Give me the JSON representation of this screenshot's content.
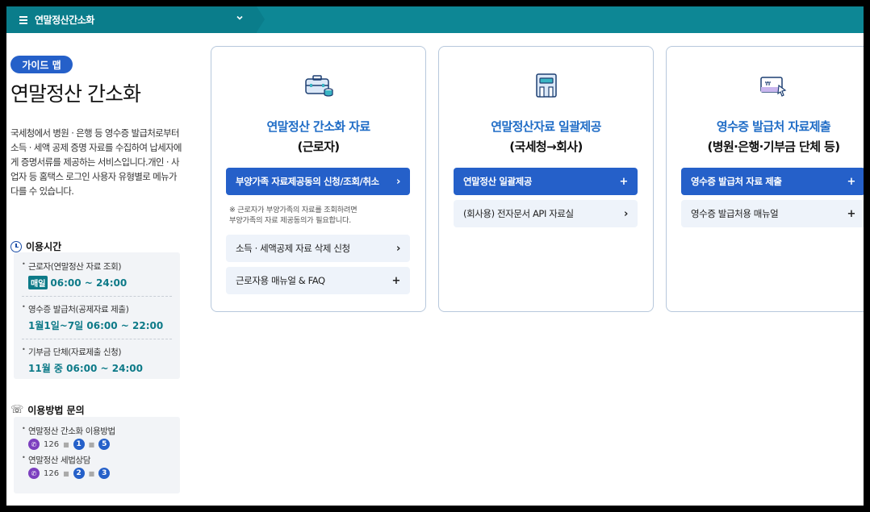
{
  "topbar": {
    "title": "연말정산간소화"
  },
  "sidebar": {
    "badge": "가이드 맵",
    "title": "연말정산 간소화",
    "description": "국세청에서 병원 · 은행 등 영수증 발급처로부터 소득 · 세액 공제 증명 자료를 수집하여 납세자에게 증명서류를 제공하는 서비스입니다.개인 · 사업자 등 홈택스 로그인 사용자 유형별로 메뉴가 다를 수 있습니다.",
    "hours_heading": "이용시간",
    "hours": [
      {
        "label": "근로자(연말정산 자료 조회)",
        "badge": "매일",
        "value": "06:00 ~ 24:00"
      },
      {
        "label": "영수증 발급처(공제자료 제출)",
        "value": "1월1일~7일 06:00 ~ 22:00"
      },
      {
        "label": "기부금 단체(자료제출 신청)",
        "value": "11월 중 06:00 ~ 24:00"
      }
    ],
    "help_heading": "이용방법 문의",
    "help": [
      {
        "label": "연말정산 간소화 이용방법",
        "phone": "126",
        "steps": [
          "1",
          "5"
        ]
      },
      {
        "label": "연말정산 세법상담",
        "phone": "126",
        "steps": [
          "2",
          "3"
        ]
      }
    ]
  },
  "cards": [
    {
      "title": "연말정산 간소화 자료",
      "subtitle": "(근로자)",
      "primary": "부양가족 자료제공동의 신청/조회/취소",
      "note_line1": "※ 근로자가 부양가족의 자료를 조회하려면",
      "note_line2": "부양가족의 자료 제공동의가 필요합니다.",
      "links": [
        "소득 · 세액공제 자료 삭제 신청",
        "근로자용 매뉴얼 & FAQ"
      ]
    },
    {
      "title": "연말정산자료 일괄제공",
      "subtitle": "(국세청→회사)",
      "primary": "연말정산 일괄제공",
      "links": [
        "(회사용) 전자문서 API 자료실"
      ]
    },
    {
      "title": "영수증 발급처 자료제출",
      "subtitle": "(병원·은행·기부금 단체 등)",
      "primary": "영수증 발급처 자료 제출",
      "links": [
        "영수증 발급처용 매뉴얼"
      ]
    }
  ],
  "icons": {
    "arrow": "›",
    "plus": "+",
    "chevron_down": "⌄",
    "phone": "☏"
  }
}
